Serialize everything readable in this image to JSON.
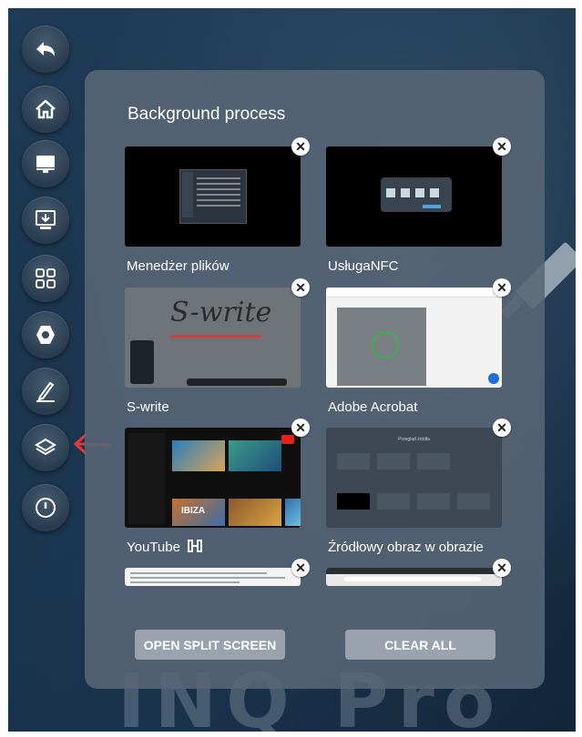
{
  "brand": {
    "text": "INQ Pro"
  },
  "sidebar": {
    "items": [
      {
        "name": "back",
        "icon": "back-arrow-icon"
      },
      {
        "name": "home",
        "icon": "home-icon"
      },
      {
        "name": "display",
        "icon": "monitor-icon"
      },
      {
        "name": "screen-share",
        "icon": "download-screen-icon"
      },
      {
        "name": "apps",
        "icon": "grid-icon"
      },
      {
        "name": "settings",
        "icon": "hexagon-settings-icon"
      },
      {
        "name": "annotate",
        "icon": "pen-icon"
      },
      {
        "name": "background-process",
        "icon": "layers-icon"
      },
      {
        "name": "power",
        "icon": "power-icon"
      }
    ],
    "annotation_arrow_color": "#e53935"
  },
  "panel": {
    "title": "Background process",
    "close_symbol": "✕",
    "cards": [
      {
        "label": "Menedżer plików",
        "thumb": "file-manager"
      },
      {
        "label": "UsługaNFC",
        "thumb": "nfc-service"
      },
      {
        "label": "S-write",
        "thumb": "s-write",
        "thumb_text": "S-write"
      },
      {
        "label": "Adobe Acrobat",
        "thumb": "acrobat"
      },
      {
        "label": "YouTube",
        "thumb": "youtube",
        "thumb_text": "IBIZA"
      },
      {
        "label": "Źródłowy obraz w obrazie",
        "thumb": "pip-source",
        "thumb_text": "Przegląd źródła"
      },
      {
        "label": "",
        "thumb": "document"
      },
      {
        "label": "",
        "thumb": "browser"
      }
    ],
    "buttons": {
      "split": "OPEN SPLIT SCREEN",
      "clear": "CLEAR ALL"
    }
  },
  "colors": {
    "panel_bg": "#586676",
    "button_bg": "#9aa3ad",
    "screen_bg": "#1a3249"
  }
}
